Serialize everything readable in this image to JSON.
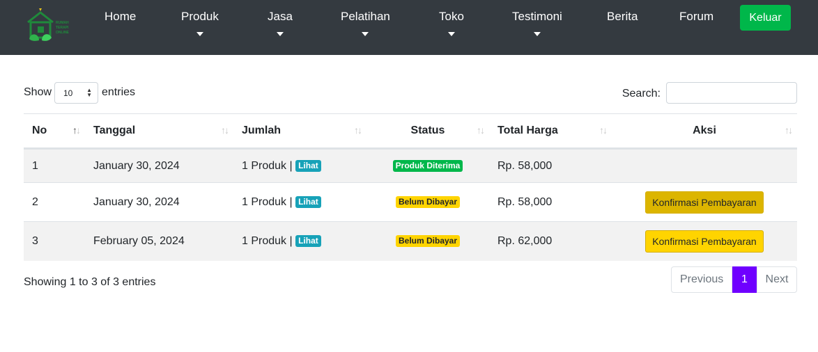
{
  "nav": {
    "logo_text": "RUMAH TERAPI ONLINE",
    "items": [
      {
        "label": "Home",
        "dropdown": false
      },
      {
        "label": "Produk",
        "dropdown": true
      },
      {
        "label": "Jasa",
        "dropdown": true
      },
      {
        "label": "Pelatihan",
        "dropdown": true
      },
      {
        "label": "Toko",
        "dropdown": true
      },
      {
        "label": "Testimoni",
        "dropdown": true
      },
      {
        "label": "Berita",
        "dropdown": false
      },
      {
        "label": "Forum",
        "dropdown": false
      }
    ],
    "logout_label": "Keluar"
  },
  "table_controls": {
    "show_label": "Show",
    "page_length": "10",
    "entries_label": "entries",
    "search_label": "Search:",
    "search_value": ""
  },
  "table": {
    "headers": [
      "No",
      "Tanggal",
      "Jumlah",
      "Status",
      "Total Harga",
      "Aksi"
    ],
    "rows": [
      {
        "no": "1",
        "tanggal": "January 30, 2024",
        "jumlah": "1 Produk |",
        "lihat": "Lihat",
        "status": "Produk Diterima",
        "status_type": "success",
        "total": "Rp. 58,000",
        "aksi": ""
      },
      {
        "no": "2",
        "tanggal": "January 30, 2024",
        "jumlah": "1 Produk |",
        "lihat": "Lihat",
        "status": "Belum Dibayar",
        "status_type": "warning",
        "total": "Rp. 58,000",
        "aksi": "Konfirmasi Pembayaran"
      },
      {
        "no": "3",
        "tanggal": "February 05, 2024",
        "jumlah": "1 Produk |",
        "lihat": "Lihat",
        "status": "Belum Dibayar",
        "status_type": "warning",
        "total": "Rp. 62,000",
        "aksi": "Konfirmasi Pembayaran"
      }
    ]
  },
  "footer": {
    "info": "Showing 1 to 3 of 3 entries",
    "previous_label": "Previous",
    "current_page": "1",
    "next_label": "Next"
  },
  "colors": {
    "navbar": "#343a40",
    "logout": "#00b74a",
    "page_active": "#6f00ff",
    "badge_info": "#17a2b8",
    "badge_success": "#00b74a",
    "badge_warning": "#ffd400"
  }
}
